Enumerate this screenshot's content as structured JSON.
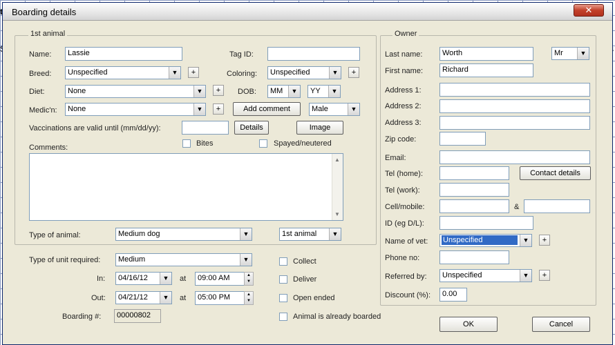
{
  "window": {
    "title": "Boarding details",
    "close": "✕"
  },
  "background": {
    "left_chars": [
      "t",
      "S"
    ],
    "right_chars": [
      "s"
    ]
  },
  "animal": {
    "legend": "1st animal",
    "name_label": "Name:",
    "name": "Lassie",
    "tag_label": "Tag ID:",
    "tag": "",
    "breed_label": "Breed:",
    "breed": "Unspecified",
    "coloring_label": "Coloring:",
    "coloring": "Unspecified",
    "diet_label": "Diet:",
    "diet": "None",
    "dob_label": "DOB:",
    "dob_month": "MM",
    "dob_year": "YY",
    "medic_label": "Medic'n:",
    "medic": "None",
    "add_comment": "Add comment",
    "sex": "Male",
    "vacc_label": "Vaccinations are valid until (mm/dd/yy):",
    "vacc": "",
    "details": "Details",
    "image": "Image",
    "comments_label": "Comments:",
    "bites": "Bites",
    "spayed": "Spayed/neutered",
    "type_label": "Type of animal:",
    "type": "Medium dog",
    "which": "1st animal",
    "plus": "+"
  },
  "unit": {
    "type_label": "Type of unit required:",
    "type": "Medium",
    "in_label": "In:",
    "in_date": "04/16/12",
    "at": "at",
    "in_time": "09:00 AM",
    "out_label": "Out:",
    "out_date": "04/21/12",
    "out_time": "05:00 PM",
    "boarding_label": "Boarding #:",
    "boarding": "00000802",
    "collect": "Collect",
    "deliver": "Deliver",
    "open_ended": "Open ended",
    "already": "Animal is already boarded"
  },
  "owner": {
    "legend": "Owner",
    "last_label": "Last name:",
    "last": "Worth",
    "title": "Mr",
    "first_label": "First name:",
    "first": "Richard",
    "addr1_label": "Address 1:",
    "addr2_label": "Address 2:",
    "addr3_label": "Address 3:",
    "zip_label": "Zip code:",
    "email_label": "Email:",
    "tel_home_label": "Tel (home):",
    "contact_details": "Contact details",
    "tel_work_label": "Tel (work):",
    "cell_label": "Cell/mobile:",
    "amp": "&",
    "id_label": "ID (eg D/L):",
    "vet_label": "Name of vet:",
    "vet": "Unspecified",
    "phone_label": "Phone no:",
    "referred_label": "Referred by:",
    "referred": "Unspecified",
    "discount_label": "Discount (%):",
    "discount": "0.00"
  },
  "buttons": {
    "ok": "OK",
    "cancel": "Cancel"
  },
  "icons": {
    "dropdown": "▼",
    "spin_up": "▲",
    "spin_down": "▼",
    "scroll_up": "▲",
    "scroll_down": "▼"
  }
}
